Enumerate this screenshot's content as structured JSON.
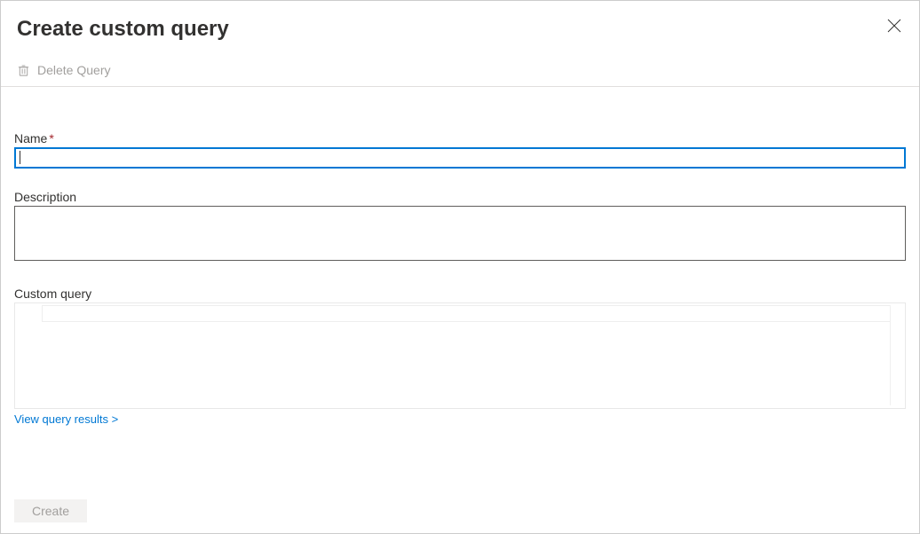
{
  "header": {
    "title": "Create custom query"
  },
  "toolbar": {
    "delete_label": "Delete Query"
  },
  "fields": {
    "name": {
      "label": "Name",
      "required": "*",
      "value": ""
    },
    "description": {
      "label": "Description",
      "value": ""
    },
    "custom_query": {
      "label": "Custom query",
      "value": ""
    }
  },
  "links": {
    "view_results": "View query results >"
  },
  "footer": {
    "create_label": "Create"
  }
}
